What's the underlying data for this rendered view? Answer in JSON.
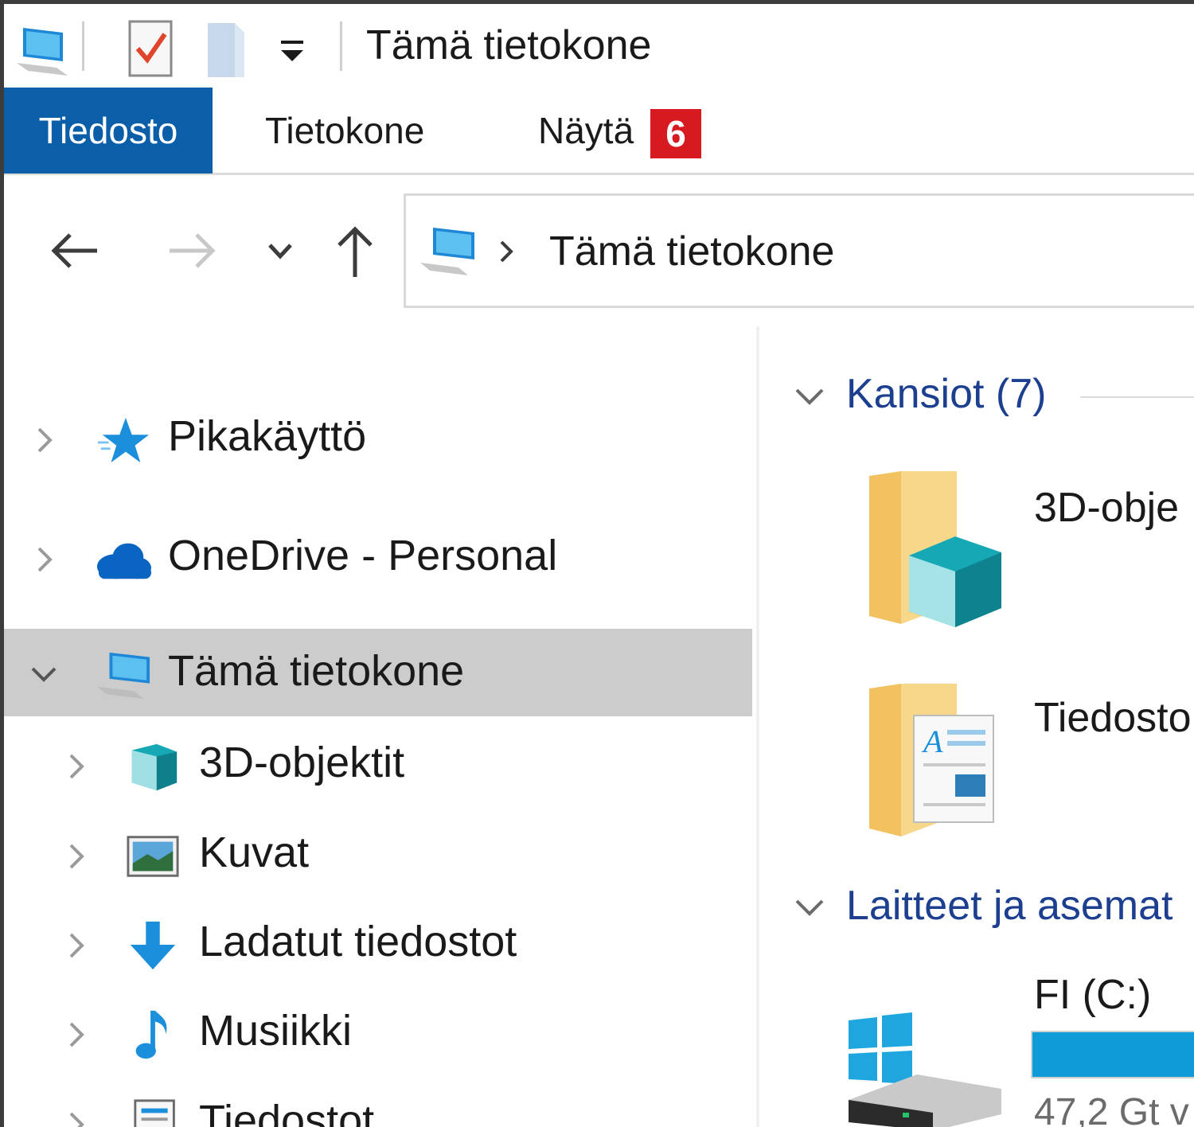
{
  "titlebar": {
    "title": "Tämä tietokone"
  },
  "ribbon": {
    "tabs": [
      "Tiedosto",
      "Tietokone",
      "Näytä"
    ],
    "badge": "6",
    "badge_color": "#d71a20",
    "active_tab_color": "#0b5ea8"
  },
  "address": {
    "path": "Tämä tietokone"
  },
  "tree": {
    "items": [
      {
        "label": "Pikakäyttö",
        "icon": "star-icon"
      },
      {
        "label": "OneDrive - Personal",
        "icon": "cloud-icon"
      },
      {
        "label": "Tämä tietokone",
        "icon": "computer-icon",
        "selected": true
      },
      {
        "label": "3D-objektit",
        "icon": "cube-icon"
      },
      {
        "label": "Kuvat",
        "icon": "pictures-icon"
      },
      {
        "label": "Ladatut tiedostot",
        "icon": "download-icon"
      },
      {
        "label": "Musiikki",
        "icon": "music-icon"
      },
      {
        "label": "Tiedostot",
        "icon": "documents-icon"
      }
    ]
  },
  "content": {
    "folders_header": "Kansiot (7)",
    "folders": [
      "3D-obje",
      "Tiedosto"
    ],
    "devices_header": "Laitteet ja asemat",
    "drive": {
      "name": "FI (C:)",
      "free": "47,2 Gt v",
      "bar_color": "#0f9ad8"
    }
  }
}
